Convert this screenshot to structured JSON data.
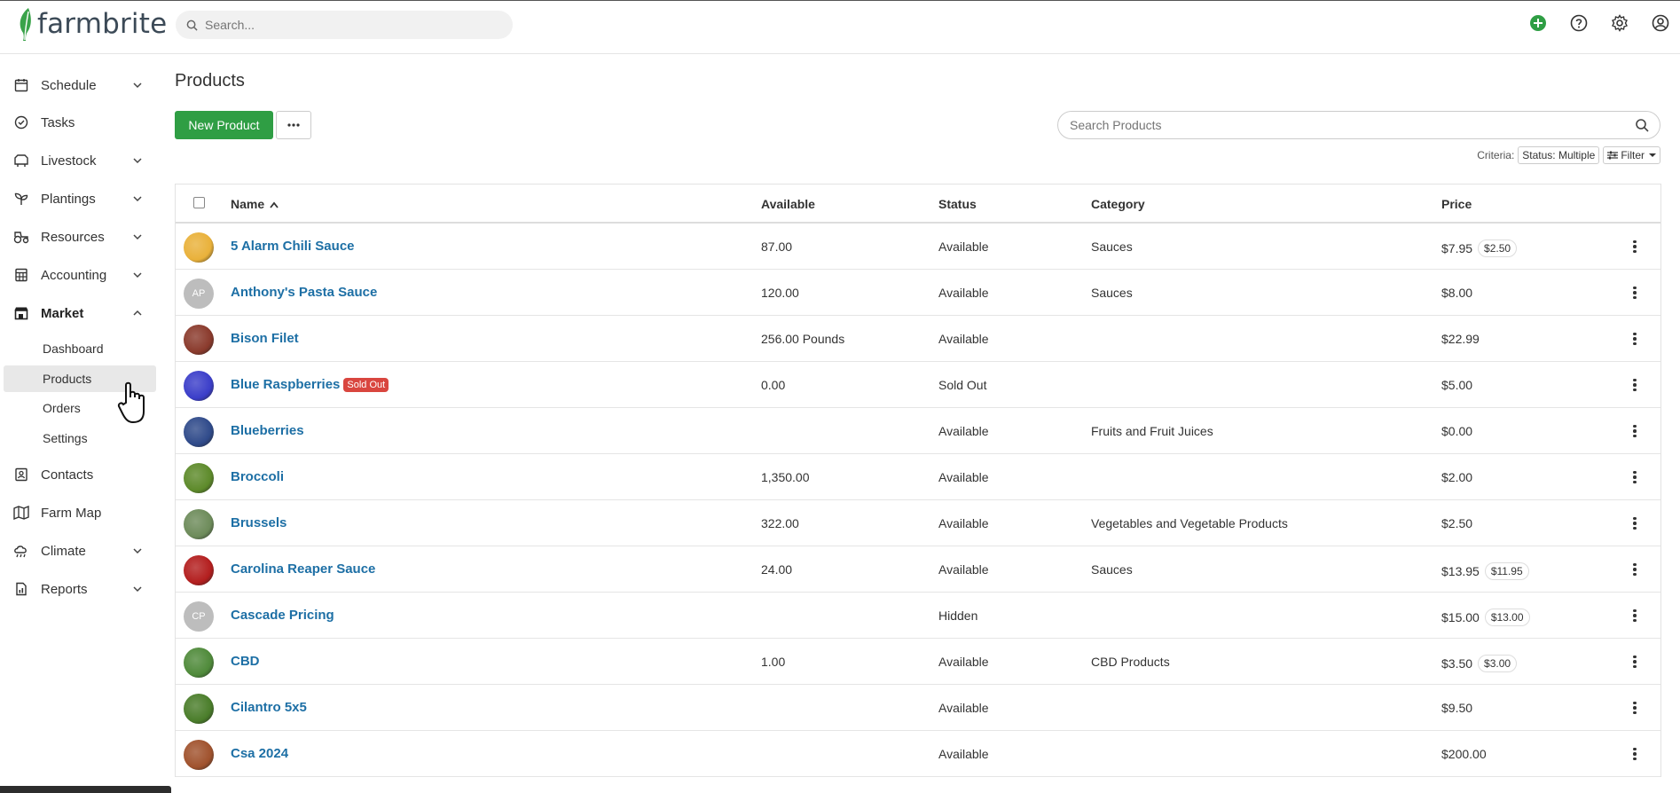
{
  "app": {
    "brand": "farmbrite",
    "search_placeholder": "Search..."
  },
  "topbar": {
    "icons": [
      "add-circle-icon",
      "help-icon",
      "settings-gear-icon",
      "account-icon"
    ],
    "accent": "#2f9e44"
  },
  "sidebar": {
    "items": [
      {
        "label": "Schedule",
        "icon": "calendar-icon",
        "chevron": "down"
      },
      {
        "label": "Tasks",
        "icon": "check-circle-icon"
      },
      {
        "label": "Livestock",
        "icon": "livestock-icon",
        "chevron": "down"
      },
      {
        "label": "Plantings",
        "icon": "sprout-icon",
        "chevron": "down"
      },
      {
        "label": "Resources",
        "icon": "tractor-icon",
        "chevron": "down"
      },
      {
        "label": "Accounting",
        "icon": "calculator-icon",
        "chevron": "down"
      },
      {
        "label": "Market",
        "icon": "store-icon",
        "chevron": "up"
      },
      {
        "label": "Contacts",
        "icon": "contacts-icon"
      },
      {
        "label": "Farm Map",
        "icon": "map-icon"
      },
      {
        "label": "Climate",
        "icon": "climate-icon",
        "chevron": "down"
      },
      {
        "label": "Reports",
        "icon": "report-icon",
        "chevron": "down"
      }
    ],
    "market_sub": [
      "Dashboard",
      "Products",
      "Orders",
      "Settings"
    ],
    "active_sub": "Products"
  },
  "main": {
    "title": "Products",
    "new_button": "New Product",
    "search_placeholder": "Search Products",
    "criteria_label": "Criteria:",
    "criteria_chip": "Status: Multiple",
    "filter_label": "Filter"
  },
  "table": {
    "columns": [
      "Name",
      "Available",
      "Status",
      "Category",
      "Price"
    ],
    "rows": [
      {
        "name": "5 Alarm Chili Sauce",
        "available": "87.00",
        "status": "Available",
        "category": "Sauces",
        "price": "$7.95",
        "sale": "$2.50",
        "avatar": "img",
        "color": "#e9b13a"
      },
      {
        "name": "Anthony's Pasta Sauce",
        "available": "120.00",
        "status": "Available",
        "category": "Sauces",
        "price": "$8.00",
        "sale": "",
        "avatar": "AP",
        "color": "#bdbdbd"
      },
      {
        "name": "Bison Filet",
        "available": "256.00 Pounds",
        "status": "Available",
        "category": "",
        "price": "$22.99",
        "sale": "",
        "avatar": "img",
        "color": "#8a3a2c"
      },
      {
        "name": "Blue Raspberries",
        "badge": "Sold Out",
        "available": "0.00",
        "status": "Sold Out",
        "category": "",
        "price": "$5.00",
        "sale": "",
        "avatar": "img",
        "color": "#3b3ec9"
      },
      {
        "name": "Blueberries",
        "available": "",
        "status": "Available",
        "category": "Fruits and Fruit Juices",
        "price": "$0.00",
        "sale": "",
        "avatar": "img",
        "color": "#2f4a8a"
      },
      {
        "name": "Broccoli",
        "available": "1,350.00",
        "status": "Available",
        "category": "",
        "price": "$2.00",
        "sale": "",
        "avatar": "img",
        "color": "#5d8a2a"
      },
      {
        "name": "Brussels",
        "available": "322.00",
        "status": "Available",
        "category": "Vegetables and Vegetable Products",
        "price": "$2.50",
        "sale": "",
        "avatar": "img",
        "color": "#6d8b5a"
      },
      {
        "name": "Carolina Reaper Sauce",
        "available": "24.00",
        "status": "Available",
        "category": "Sauces",
        "price": "$13.95",
        "sale": "$11.95",
        "avatar": "img",
        "color": "#b31e1e"
      },
      {
        "name": "Cascade Pricing",
        "available": "",
        "status": "Hidden",
        "category": "",
        "price": "$15.00",
        "sale": "$13.00",
        "avatar": "CP",
        "color": "#bdbdbd"
      },
      {
        "name": "CBD",
        "available": "1.00",
        "status": "Available",
        "category": "CBD Products",
        "price": "$3.50",
        "sale": "$3.00",
        "avatar": "img",
        "color": "#4f8a3a"
      },
      {
        "name": "Cilantro 5x5",
        "available": "",
        "status": "Available",
        "category": "",
        "price": "$9.50",
        "sale": "",
        "avatar": "img",
        "color": "#4a7d2a"
      },
      {
        "name": "Csa 2024",
        "available": "",
        "status": "Available",
        "category": "",
        "price": "$200.00",
        "sale": "",
        "avatar": "img",
        "color": "#a0522d"
      }
    ]
  }
}
